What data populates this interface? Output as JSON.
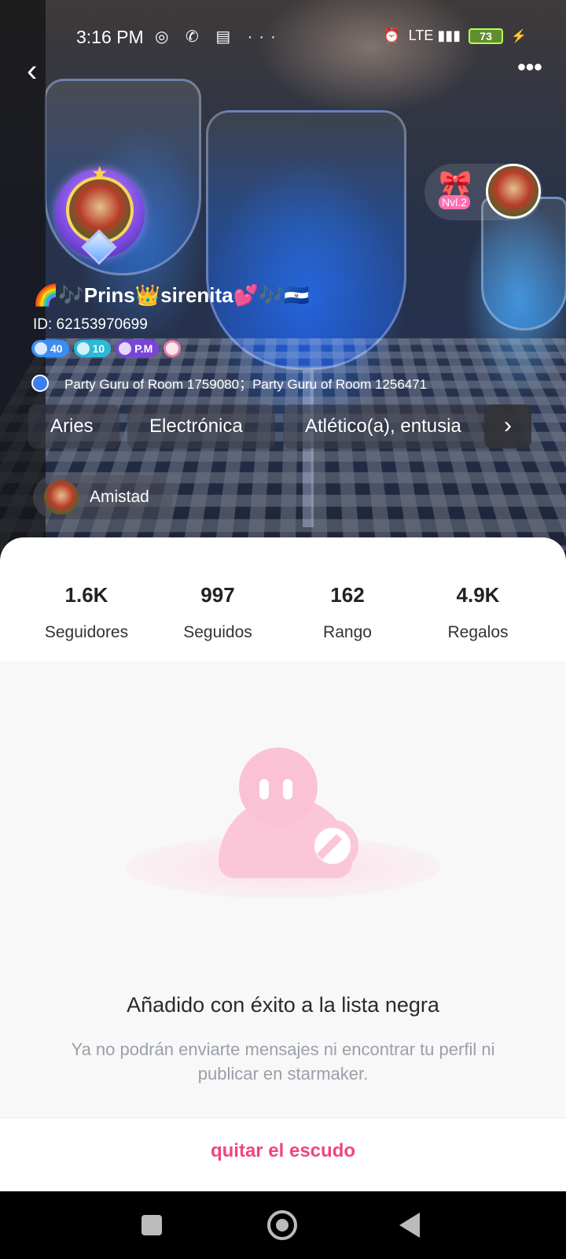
{
  "status_bar": {
    "time": "3:16 PM",
    "left_icons": [
      "whatsapp-icon",
      "missed-call-icon",
      "message-icon",
      "more-dots-icon"
    ],
    "left_icons_glyphs": "◎ ✆ ▤ ···",
    "right_icons": [
      "alarm-icon",
      "lte-signal-icon"
    ],
    "alarm_glyph": "⏰",
    "signal_glyph": "LTE ▮▮▮",
    "battery": "73",
    "bolt_glyph": "⚡"
  },
  "header": {
    "back_glyph": "‹",
    "more_glyph": "•••"
  },
  "profile": {
    "username": "🌈🎶Prins👑sirenita💕🎶🇸🇻",
    "id_text": "ID: 62153970699",
    "badges": [
      {
        "label": "40",
        "icon": "diamond-icon"
      },
      {
        "label": "10",
        "icon": "crystal-icon"
      },
      {
        "label": "P.M",
        "icon": "group-icon"
      },
      {
        "label": "",
        "icon": "bow-icon"
      }
    ],
    "party_text": "Party Guru of Room 1759080；Party Guru of Room 1256471",
    "nvl_label": "Nvl.2",
    "bow_glyph": "🎀",
    "star_glyph": "★"
  },
  "tags": {
    "items": [
      "Aries",
      "Electrónica",
      "Atlético(a), entusia"
    ],
    "arrow_glyph": "›"
  },
  "friend_chip": {
    "label": "Amistad"
  },
  "stats": [
    {
      "value": "1.6K",
      "label": "Seguidores"
    },
    {
      "value": "997",
      "label": "Seguidos"
    },
    {
      "value": "162",
      "label": "Rango"
    },
    {
      "value": "4.9K",
      "label": "Regalos"
    }
  ],
  "blocked": {
    "title": "Añadido con éxito a la lista negra",
    "description": "Ya no podrán enviarte mensajes ni encontrar tu perfil ni publicar en starmaker.",
    "button": "quitar el escudo"
  },
  "colors": {
    "accent": "#f0457f",
    "battery": "#b8ff4a"
  }
}
